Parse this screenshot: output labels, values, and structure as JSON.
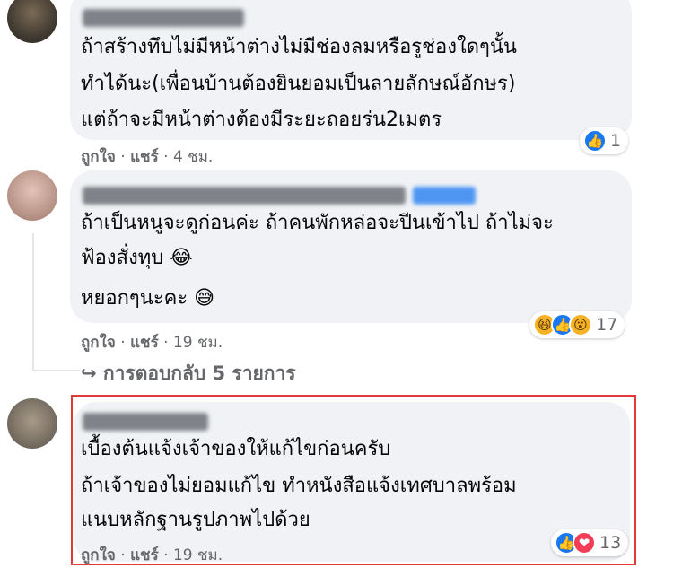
{
  "comments": [
    {
      "author": "Ponamat Nakama",
      "lines": [
        "ถ้าสร้างทึบไม่มีหน้าต่างไม่มีช่องลมหรือรูช่องใดๆนั้น",
        "ทำได้นะ(เพื่อนบ้านต้องยินยอมเป็นลายลักษณ์อักษร)",
        "แต่ถ้าจะมีหน้าต่างต้องมีระยะถอยร่น2เมตร"
      ],
      "like_label": "ถูกใจ",
      "sep1": "·",
      "share_label": "แชร์",
      "sep2": "·",
      "time": "4 ชม.",
      "reaction_count": "1",
      "reactions": [
        "like-icon"
      ]
    },
    {
      "author": "Kannaphat Mattanakannasachot",
      "author_badge": "ติดตาม",
      "lines": [
        "ถ้าเป็นหนูจะดูก่อนค่ะ ถ้าคนพักหล่อจะปีนเข้าไป ถ้าไม่จะ",
        "ฟ้องสั่งทุบ 😂",
        "หยอกๆนะคะ 😅"
      ],
      "like_label": "ถูกใจ",
      "sep1": "·",
      "share_label": "แชร์",
      "sep2": "·",
      "time": "19 ชม.",
      "reaction_count": "17",
      "reactions": [
        "haha-icon",
        "like-icon",
        "wow-icon"
      ]
    },
    {
      "author": "Piti Srisathapo",
      "lines": [
        "เบื้องต้นแจ้งเจ้าของให้แก้ไขก่อนครับ",
        "ถ้าเจ้าของไม่ยอมแก้ไข ทำหนังสือแจ้งเทศบาลพร้อม",
        "แนบหลักฐานรูปภาพไปด้วย"
      ],
      "like_label": "ถูกใจ",
      "sep1": "·",
      "share_label": "แชร์",
      "sep2": "·",
      "time": "19 ชม.",
      "reaction_count": "13",
      "reactions": [
        "like-icon",
        "love-icon"
      ]
    }
  ],
  "replies_link": "↪ การตอบกลับ 5 รายการ",
  "colors": {
    "bubble": "#f0f2f5",
    "meta": "#65676b",
    "like": "#1877f2",
    "highlight": "#e03a3a"
  }
}
